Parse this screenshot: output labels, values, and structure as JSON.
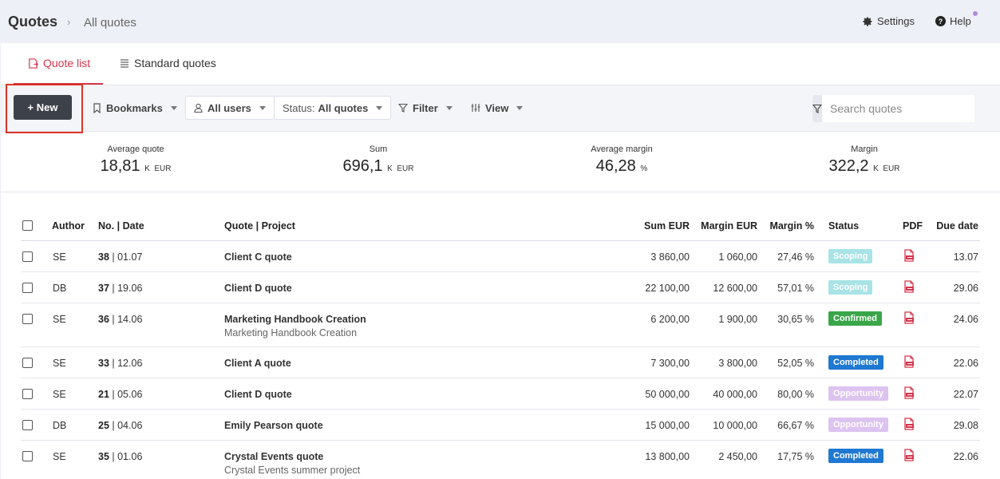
{
  "header": {
    "title": "Quotes",
    "separator": "›",
    "subtitle": "All quotes",
    "settings_label": "Settings",
    "help_label": "Help"
  },
  "tabs": [
    {
      "label": "Quote list",
      "active": true
    },
    {
      "label": "Standard quotes",
      "active": false
    }
  ],
  "toolbar": {
    "new_label": "+ New",
    "bookmarks_label": "Bookmarks",
    "users_label": "All users",
    "status_prefix": "Status:",
    "status_value": "All quotes",
    "filter_label": "Filter",
    "view_label": "View",
    "search_placeholder": "Search quotes"
  },
  "stats": [
    {
      "label": "Average quote",
      "value": "18,81",
      "suffix": "K",
      "unit": "EUR"
    },
    {
      "label": "Sum",
      "value": "696,1",
      "suffix": "K",
      "unit": "EUR"
    },
    {
      "label": "Average margin",
      "value": "46,28",
      "suffix": "",
      "unit": "%"
    },
    {
      "label": "Margin",
      "value": "322,2",
      "suffix": "K",
      "unit": "EUR"
    }
  ],
  "table": {
    "columns": {
      "author": "Author",
      "no": "No.",
      "date": "Date",
      "quote": "Quote",
      "project": "Project",
      "sum": "Sum EUR",
      "margin_eur": "Margin EUR",
      "margin_pct": "Margin %",
      "status": "Status",
      "pdf": "PDF",
      "due": "Due date"
    },
    "colors": {
      "Scoping": "#a8e3e6",
      "Confirmed": "#3aa64a",
      "Completed": "#1f78d1",
      "Opportunity": "#dcc3f0"
    },
    "rows": [
      {
        "author": "SE",
        "no": "38",
        "date": "01.07",
        "quote": "Client C quote",
        "project": "",
        "sum": "3 860,00",
        "margin_eur": "1 060,00",
        "margin_pct": "27,46 %",
        "status": "Scoping",
        "due": "13.07"
      },
      {
        "author": "DB",
        "no": "37",
        "date": "19.06",
        "quote": "Client D quote",
        "project": "",
        "sum": "22 100,00",
        "margin_eur": "12 600,00",
        "margin_pct": "57,01 %",
        "status": "Scoping",
        "due": "29.06"
      },
      {
        "author": "SE",
        "no": "36",
        "date": "14.06",
        "quote": "Marketing Handbook Creation",
        "project": "Marketing Handbook Creation",
        "sum": "6 200,00",
        "margin_eur": "1 900,00",
        "margin_pct": "30,65 %",
        "status": "Confirmed",
        "due": "24.06"
      },
      {
        "author": "SE",
        "no": "33",
        "date": "12.06",
        "quote": "Client A quote",
        "project": "",
        "sum": "7 300,00",
        "margin_eur": "3 800,00",
        "margin_pct": "52,05 %",
        "status": "Completed",
        "due": "22.06"
      },
      {
        "author": "SE",
        "no": "21",
        "date": "05.06",
        "quote": "Client D quote",
        "project": "",
        "sum": "50 000,00",
        "margin_eur": "40 000,00",
        "margin_pct": "80,00 %",
        "status": "Opportunity",
        "due": "22.07"
      },
      {
        "author": "DB",
        "no": "25",
        "date": "04.06",
        "quote": "Emily Pearson quote",
        "project": "",
        "sum": "15 000,00",
        "margin_eur": "10 000,00",
        "margin_pct": "66,67 %",
        "status": "Opportunity",
        "due": "29.08"
      },
      {
        "author": "SE",
        "no": "35",
        "date": "01.06",
        "quote": "Crystal Events quote",
        "project": "Crystal Events summer project",
        "sum": "13 800,00",
        "margin_eur": "2 450,00",
        "margin_pct": "17,75 %",
        "status": "Completed",
        "due": "22.06"
      }
    ]
  }
}
